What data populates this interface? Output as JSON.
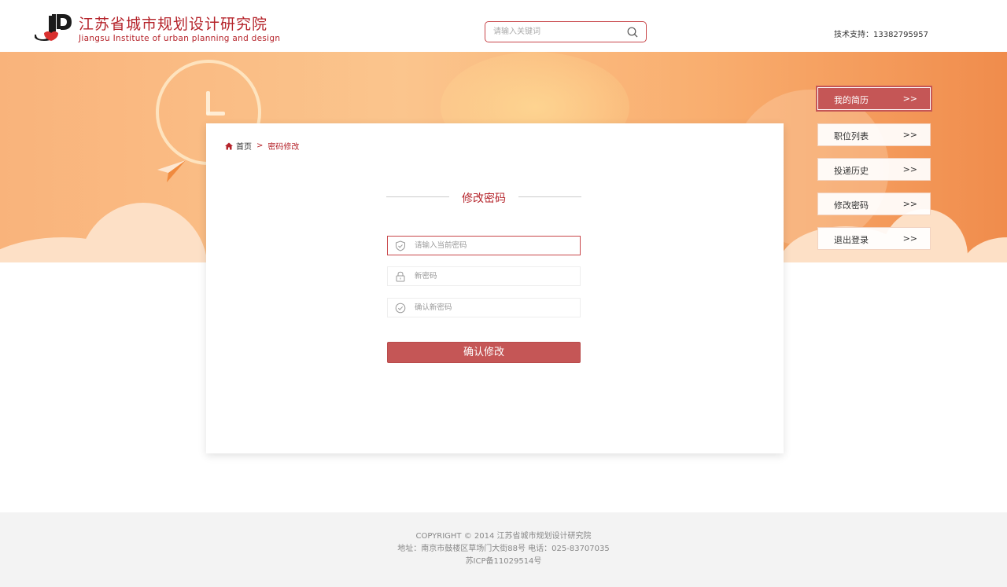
{
  "header": {
    "brand_cn": "江苏省城市规划设计研究院",
    "brand_en": "Jiangsu Institute of urban planning and design",
    "search_placeholder": "请输入关键词",
    "support": "技术支持：13382795957"
  },
  "breadcrumb": {
    "home": "首页",
    "separator": ">",
    "current": "密码修改"
  },
  "form": {
    "title": "修改密码",
    "fields": [
      {
        "placeholder": "请输入当前密码",
        "icon": "shield-icon"
      },
      {
        "placeholder": "新密码",
        "icon": "lock-icon"
      },
      {
        "placeholder": "确认新密码",
        "icon": "check-circle-icon"
      }
    ],
    "submit_label": "确认修改"
  },
  "menu": [
    {
      "label": "我的简历",
      "arrow": ">>",
      "active": true
    },
    {
      "label": "职位列表",
      "arrow": ">>"
    },
    {
      "label": "投递历史",
      "arrow": ">>"
    },
    {
      "label": "修改密码",
      "arrow": ">>"
    },
    {
      "label": "退出登录",
      "arrow": ">>"
    }
  ],
  "footer": {
    "copyright": "COPYRIGHT © 2014 江苏省城市规划设计研究院",
    "address": "地址：南京市鼓楼区草场门大街88号 电话：025-83707035",
    "icp": "苏ICP备11029514号"
  },
  "colors": {
    "brand": "#b5242b",
    "button": "#c55656",
    "banner": "#f9b37b"
  }
}
